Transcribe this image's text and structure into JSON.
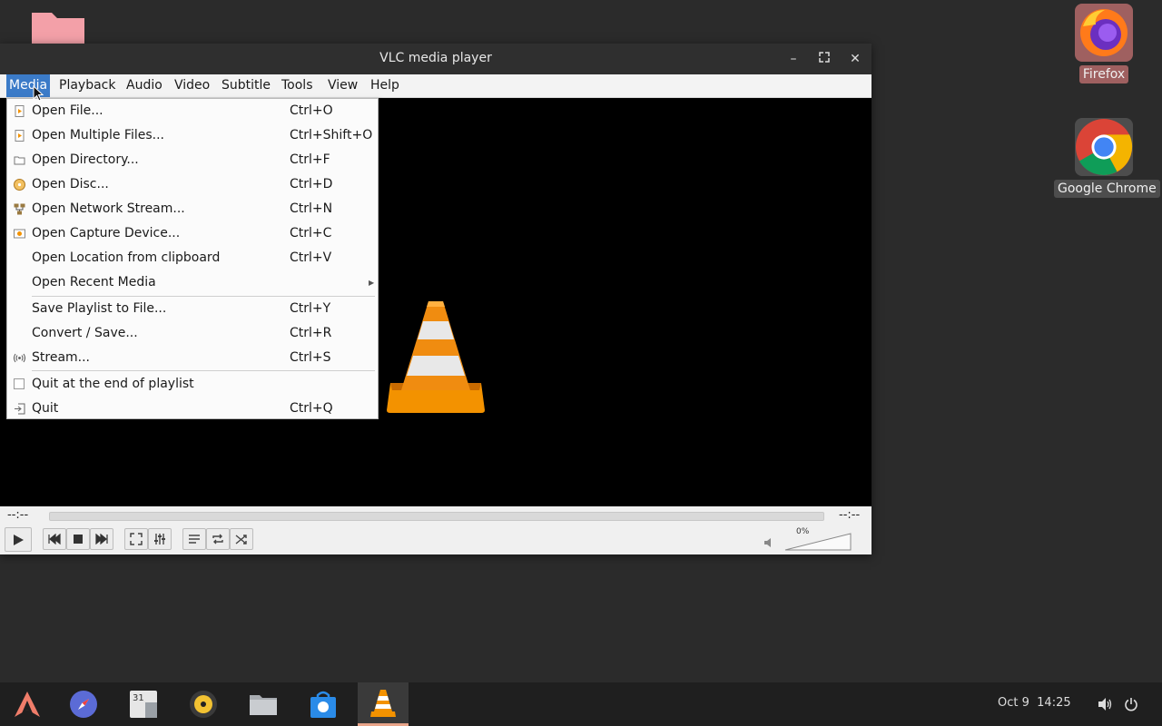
{
  "window": {
    "title": "VLC media player"
  },
  "menubar": [
    "Media",
    "Playback",
    "Audio",
    "Video",
    "Subtitle",
    "Tools",
    "View",
    "Help"
  ],
  "media_menu": [
    {
      "label": "Open File...",
      "shortcut": "Ctrl+O",
      "icon": "open-file-icon"
    },
    {
      "label": "Open Multiple Files...",
      "shortcut": "Ctrl+Shift+O",
      "icon": "open-file-icon"
    },
    {
      "label": "Open Directory...",
      "shortcut": "Ctrl+F",
      "icon": "folder-icon"
    },
    {
      "label": "Open Disc...",
      "shortcut": "Ctrl+D",
      "icon": "disc-icon"
    },
    {
      "label": "Open Network Stream...",
      "shortcut": "Ctrl+N",
      "icon": "network-icon"
    },
    {
      "label": "Open Capture Device...",
      "shortcut": "Ctrl+C",
      "icon": "capture-device-icon"
    },
    {
      "label": "Open Location from clipboard",
      "shortcut": "Ctrl+V",
      "icon": ""
    },
    {
      "label": "Open Recent Media",
      "shortcut": "",
      "icon": "",
      "submenu": true
    },
    {
      "label": "Save Playlist to File...",
      "shortcut": "Ctrl+Y",
      "icon": ""
    },
    {
      "label": "Convert / Save...",
      "shortcut": "Ctrl+R",
      "icon": ""
    },
    {
      "label": "Stream...",
      "shortcut": "Ctrl+S",
      "icon": "stream-icon"
    },
    {
      "label": "Quit at the end of playlist",
      "shortcut": "",
      "icon": "",
      "checkbox": true,
      "checked": false
    },
    {
      "label": "Quit",
      "shortcut": "Ctrl+Q",
      "icon": "quit-icon"
    }
  ],
  "player": {
    "time_elapsed": "--:--",
    "time_total": "--:--",
    "seek_progress": 0,
    "volume": "0%"
  },
  "desktop": {
    "icons": [
      "Firefox",
      "Google Chrome"
    ]
  },
  "taskbar": {
    "date": "Oct 9",
    "time": "14:25"
  },
  "colors": {
    "accent": "#3b7bc8",
    "vlc_orange": "#f39200",
    "titlebar": "#2f2f2f"
  }
}
